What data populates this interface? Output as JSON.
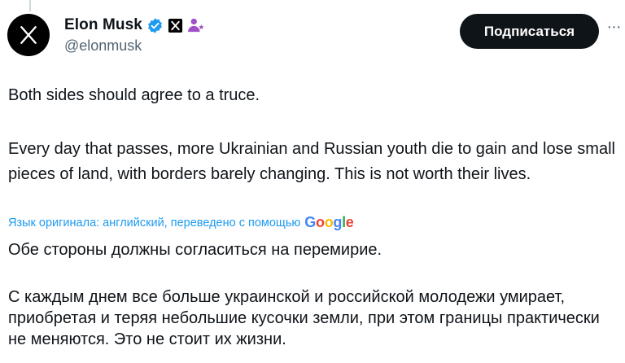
{
  "author": {
    "display_name": "Elon Musk",
    "handle": "@elonmusk",
    "avatar_icon": "x-logo-icon",
    "badges": [
      "verified-badge-icon",
      "x-affiliate-icon",
      "parody-person-icon"
    ]
  },
  "actions": {
    "follow_label": "Подписаться",
    "more_label": "···"
  },
  "tweet": {
    "paragraphs": [
      "Both sides should agree to a truce.",
      "Every day that passes, more Ukrainian and Russian youth die to gain and lose small pieces of land, with borders barely changing. This is not worth their lives."
    ]
  },
  "translation": {
    "note": "Язык оригинала: английский, переведено с помощью",
    "provider": "Google",
    "paragraphs": [
      "Обе стороны должны согласиться на перемирие.",
      "С каждым днем все больше украинской и российской молодежи умирает, приобретая и теряя небольшие кусочки земли, при этом границы практически не меняются. Это не стоит их жизни."
    ]
  },
  "colors": {
    "accent_blue": "#1d9bf0",
    "text_primary": "#0f1419",
    "text_secondary": "#536471",
    "parody_purple": "#a050c8"
  }
}
